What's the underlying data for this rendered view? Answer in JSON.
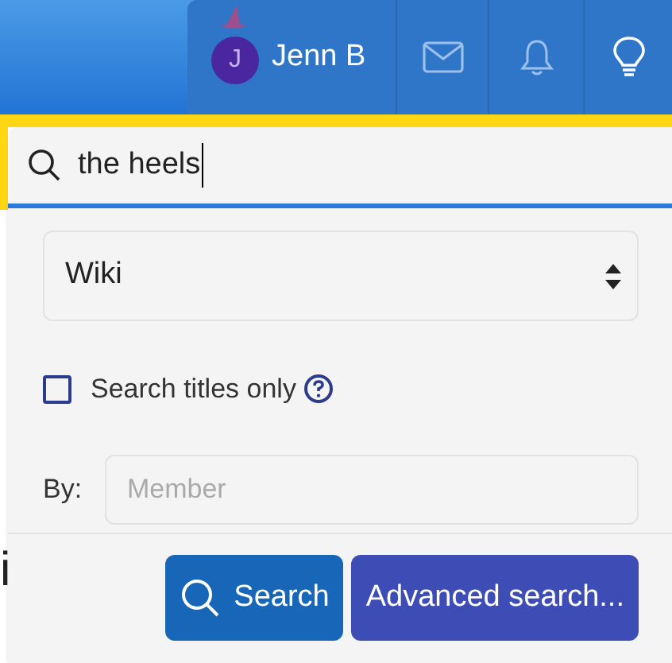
{
  "header": {
    "user": {
      "initial": "J",
      "name": "Jenn B"
    }
  },
  "search": {
    "value": "the heels",
    "scope": "Wiki",
    "titles_only": {
      "label": "Search titles only",
      "checked": false
    },
    "by": {
      "label": "By:",
      "placeholder": "Member"
    },
    "buttons": [
      {
        "label": "Search",
        "kind": "primary"
      },
      {
        "label": "Advanced search...",
        "kind": "secondary"
      }
    ]
  },
  "background_text": "i"
}
